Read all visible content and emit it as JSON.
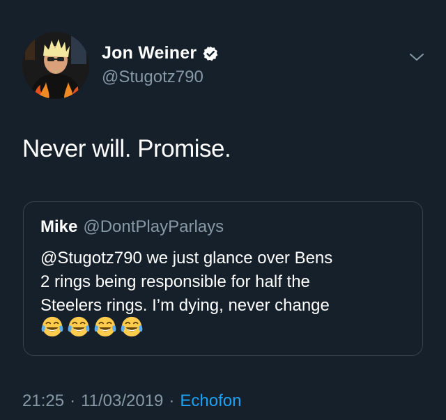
{
  "author": {
    "display_name": "Jon Weiner",
    "handle": "@Stugotz790",
    "verified": true
  },
  "tweet": {
    "text": "Never will. Promise."
  },
  "quoted_tweet": {
    "display_name": "Mike",
    "handle": "@DontPlayParlays",
    "lines": [
      "@Stugotz790 we just glance over Bens",
      "2 rings being responsible for half the",
      "Steelers rings. I’m dying, never change"
    ],
    "emoji": [
      "tears-of-joy",
      "tears-of-joy",
      "tears-of-joy",
      "tears-of-joy"
    ]
  },
  "meta": {
    "time": "21:25",
    "separator": "·",
    "date": "11/03/2019",
    "source": "Echofon"
  },
  "colors": {
    "background": "#15202b",
    "secondary_text": "#8899a6",
    "link": "#1da1f2",
    "border": "#38444d"
  }
}
